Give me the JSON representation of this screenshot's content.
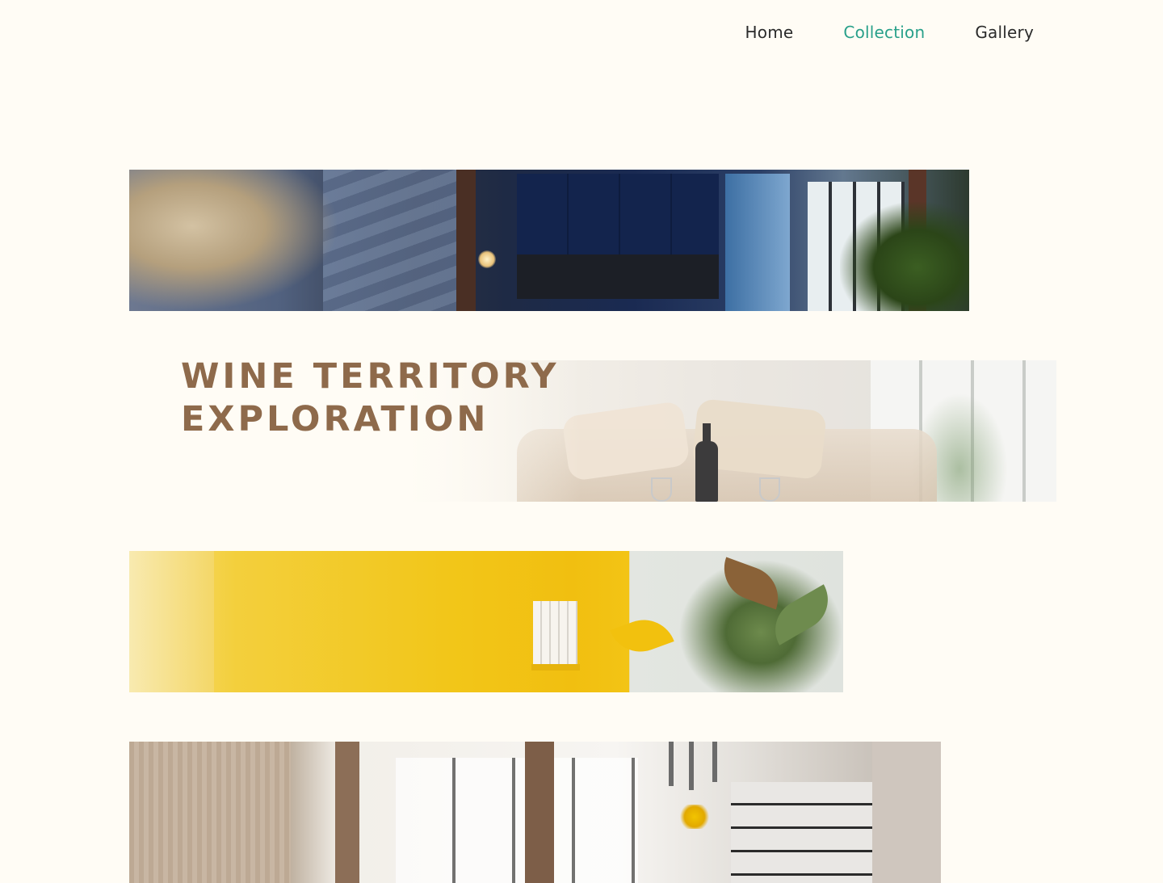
{
  "nav": {
    "items": [
      {
        "label": "Home",
        "active": false
      },
      {
        "label": "Collection",
        "active": true
      },
      {
        "label": "Gallery",
        "active": false
      }
    ],
    "active_color": "#28a08a"
  },
  "hero": {
    "title": "WINE TERRITORY EXPLORATION"
  },
  "banners": [
    {
      "subject": "dark-blue-kitchen-photo"
    },
    {
      "subject": "living-room-wine-photo"
    },
    {
      "subject": "yellow-room-plant-photo"
    },
    {
      "subject": "bright-kitchen-photo"
    }
  ],
  "colors": {
    "background": "#fffcf5",
    "title": "#8e6a4b",
    "nav_text": "#2b2b2b"
  }
}
